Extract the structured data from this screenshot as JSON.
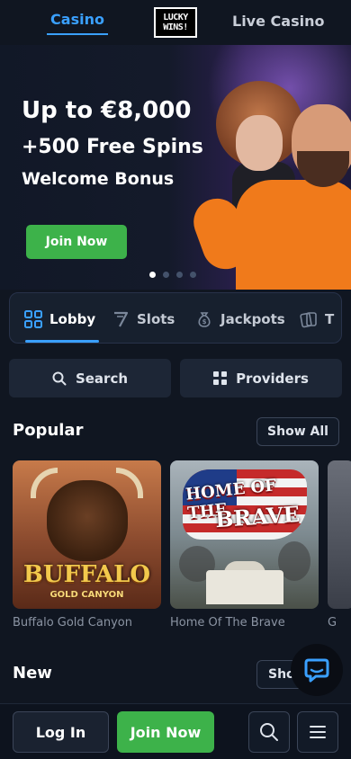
{
  "header": {
    "tabs": [
      {
        "label": "Casino",
        "active": true
      },
      {
        "label": "Live Casino",
        "active": false
      }
    ],
    "logo": {
      "line1": "LUCKY",
      "line2": "WINS!"
    }
  },
  "hero": {
    "headline": "Up to €8,000",
    "subheadline": "+500 Free Spins",
    "tagline": "Welcome Bonus",
    "cta": "Join Now",
    "slide_count": 4,
    "active_slide": 1
  },
  "categories": {
    "items": [
      {
        "label": "Lobby",
        "icon": "grid-icon",
        "active": true
      },
      {
        "label": "Slots",
        "icon": "seven-icon",
        "active": false
      },
      {
        "label": "Jackpots",
        "icon": "money-bag-icon",
        "active": false
      },
      {
        "label": "T",
        "icon": "cards-icon",
        "active": false
      }
    ]
  },
  "search": {
    "label": "Search"
  },
  "providers": {
    "label": "Providers"
  },
  "popular": {
    "title": "Popular",
    "show_all": "Show All",
    "games": [
      {
        "name": "Buffalo Gold Canyon",
        "art_title": "BUFFALO",
        "art_sub": "GOLD CANYON"
      },
      {
        "name": "Home Of The Brave",
        "art_title_top": "HOME OF THE",
        "art_title_bottom": "BRAVE"
      },
      {
        "name": "G"
      }
    ]
  },
  "new_section": {
    "title": "New",
    "show_all": "Sho"
  },
  "bottom_bar": {
    "login": "Log In",
    "join": "Join Now"
  },
  "colors": {
    "accent": "#3aa0ff",
    "cta_green": "#3db24a",
    "background": "#101621"
  }
}
